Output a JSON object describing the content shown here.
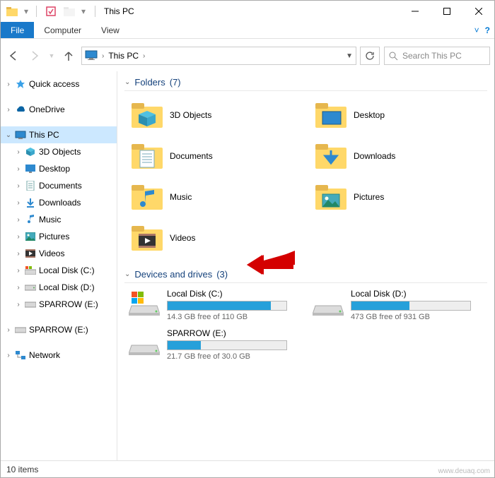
{
  "window": {
    "title": "This PC",
    "status_text": "10 items",
    "watermark": "www.deuaq.com"
  },
  "ribbon": {
    "file": "File",
    "computer": "Computer",
    "view": "View"
  },
  "address": {
    "location_label": "This PC",
    "crumb_chevron": "›"
  },
  "search": {
    "placeholder": "Search This PC"
  },
  "tree": {
    "quick_access": "Quick access",
    "onedrive": "OneDrive",
    "this_pc": "This PC",
    "children": {
      "objects3d": "3D Objects",
      "desktop": "Desktop",
      "documents": "Documents",
      "downloads": "Downloads",
      "music": "Music",
      "pictures": "Pictures",
      "videos": "Videos",
      "localc": "Local Disk (C:)",
      "locald": "Local Disk (D:)",
      "sparrow": "SPARROW (E:)"
    },
    "sparrow_removable": "SPARROW (E:)",
    "network": "Network"
  },
  "sections": {
    "folders": {
      "label": "Folders",
      "count": "(7)"
    },
    "drives": {
      "label": "Devices and drives",
      "count": "(3)"
    }
  },
  "folders": {
    "objects3d": "3D Objects",
    "desktop": "Desktop",
    "documents": "Documents",
    "downloads": "Downloads",
    "music": "Music",
    "pictures": "Pictures",
    "videos": "Videos"
  },
  "drives": [
    {
      "name": "Local Disk (C:)",
      "free_text": "14.3 GB free of 110 GB",
      "fill_pct": 87,
      "type": "os"
    },
    {
      "name": "Local Disk (D:)",
      "free_text": "473 GB free of 931 GB",
      "fill_pct": 49,
      "type": "hdd"
    },
    {
      "name": "SPARROW (E:)",
      "free_text": "21.7 GB free of 30.0 GB",
      "fill_pct": 28,
      "type": "usb"
    }
  ]
}
